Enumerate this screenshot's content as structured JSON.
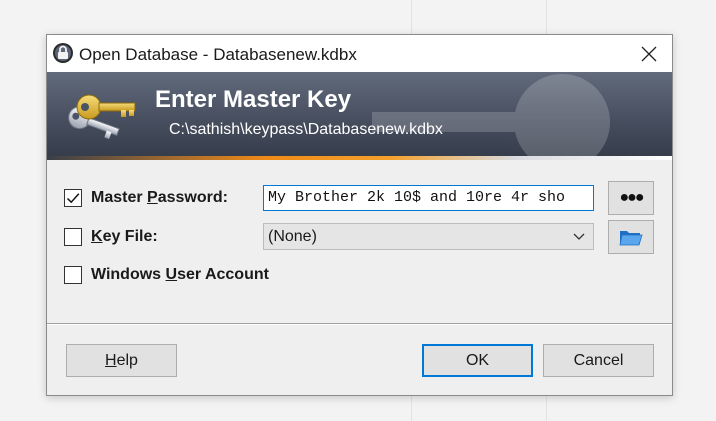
{
  "window": {
    "title": "Open Database - Databasenew.kdbx",
    "close_icon": "close-icon"
  },
  "banner": {
    "title": "Enter Master Key",
    "path": "C:\\sathish\\keypass\\Databasenew.kdbx",
    "icon": "key-icon"
  },
  "fields": {
    "master_password": {
      "label_pre": "Master ",
      "label_accel": "P",
      "label_post": "assword:",
      "checked": true,
      "value": "My Brother 2k 10$ and 10re 4r sho",
      "toggle_label": "●●●"
    },
    "key_file": {
      "label_pre": "",
      "label_accel": "K",
      "label_post": "ey File:",
      "checked": false,
      "selected": "(None)",
      "browse_icon": "folder-icon"
    },
    "windows_user_account": {
      "label_pre": "Windows ",
      "label_accel": "U",
      "label_post": "ser Account",
      "checked": false
    }
  },
  "buttons": {
    "help_accel": "H",
    "help_rest": "elp",
    "ok": "OK",
    "cancel": "Cancel"
  },
  "colors": {
    "accent": "#0078d7",
    "banner_stripe": "#f08a17"
  }
}
